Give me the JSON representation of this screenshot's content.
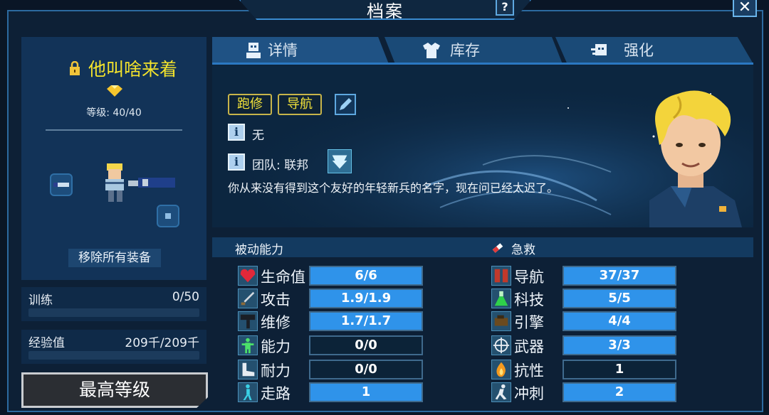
{
  "window": {
    "title": "档案",
    "help_label": "?",
    "close_label": "✕"
  },
  "crew": {
    "name": "他叫啥来着",
    "level_text": "等级: 40/40",
    "remove_equipment_label": "移除所有装备"
  },
  "stats": {
    "training": {
      "label": "训练",
      "value": "0/50",
      "progress": 0
    },
    "experience": {
      "label": "经验值",
      "value": "209千/209千",
      "progress": 0
    }
  },
  "max_level_label": "最高等级",
  "tabs": [
    {
      "label": "详情",
      "icon": "person-icon"
    },
    {
      "label": "库存",
      "icon": "shirt-icon"
    },
    {
      "label": "强化",
      "icon": "upgrade-icon"
    }
  ],
  "details": {
    "skills": [
      "跑修",
      "导航"
    ],
    "info_line": "无",
    "team_line": "团队: 联邦",
    "description": "你从来没有得到这个友好的年轻新兵的名字，现在问已经太迟了。"
  },
  "passive": {
    "title": "被动能力",
    "rows": [
      {
        "name": "生命值",
        "value": "6/6",
        "fill": 1.0,
        "icon": "heart-icon"
      },
      {
        "name": "攻击",
        "value": "1.9/1.9",
        "fill": 1.0,
        "icon": "sword-icon"
      },
      {
        "name": "维修",
        "value": "1.7/1.7",
        "fill": 1.0,
        "icon": "hammer-icon"
      },
      {
        "name": "能力",
        "value": "0/0",
        "fill": 0.0,
        "icon": "ability-icon"
      },
      {
        "name": "耐力",
        "value": "0/0",
        "fill": 0.0,
        "icon": "boot-icon"
      },
      {
        "name": "走路",
        "value": "1",
        "fill": 1.0,
        "icon": "walk-icon"
      }
    ]
  },
  "firstaid": {
    "title": "急救",
    "rows": [
      {
        "name": "导航",
        "value": "37/37",
        "fill": 1.0,
        "icon": "pilot-icon"
      },
      {
        "name": "科技",
        "value": "5/5",
        "fill": 1.0,
        "icon": "flask-icon"
      },
      {
        "name": "引擎",
        "value": "4/4",
        "fill": 1.0,
        "icon": "engine-icon"
      },
      {
        "name": "武器",
        "value": "3/3",
        "fill": 1.0,
        "icon": "crosshair-icon"
      },
      {
        "name": "抗性",
        "value": "1",
        "fill": 0.0,
        "icon": "fire-icon"
      },
      {
        "name": "冲刺",
        "value": "2",
        "fill": 1.0,
        "icon": "run-icon"
      }
    ]
  },
  "colors": {
    "accent": "#2f93ea",
    "name": "#f3e32c",
    "panel": "#123358"
  }
}
